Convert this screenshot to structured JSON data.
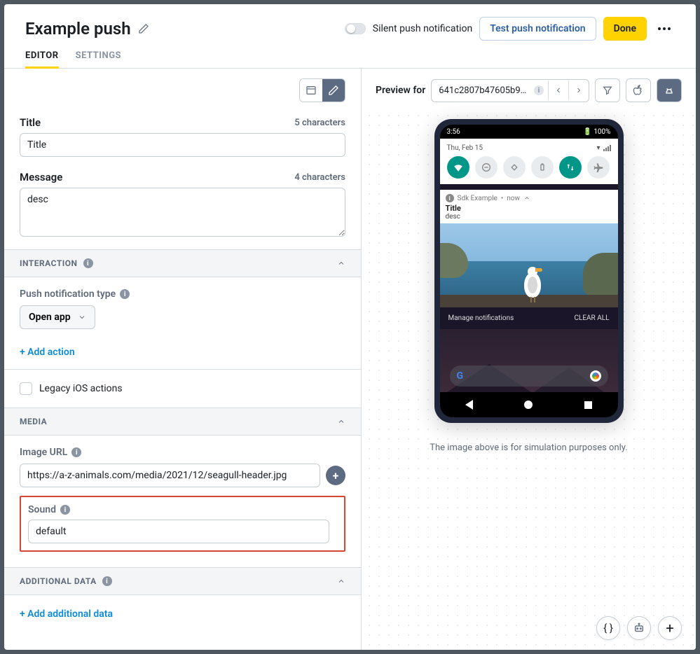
{
  "header": {
    "title": "Example push",
    "silent_label": "Silent push notification",
    "test_btn": "Test push notification",
    "done_btn": "Done"
  },
  "tabs": {
    "editor": "EDITOR",
    "settings": "SETTINGS"
  },
  "form": {
    "title_label": "Title",
    "title_count": "5 characters",
    "title_value": "Title",
    "message_label": "Message",
    "message_count": "4 characters",
    "message_value": "desc"
  },
  "interaction": {
    "section": "INTERACTION",
    "type_label": "Push notification type",
    "type_value": "Open app",
    "add_action": "+ Add action",
    "legacy_label": "Legacy iOS actions"
  },
  "media": {
    "section": "MEDIA",
    "image_label": "Image URL",
    "image_value": "https://a-z-animals.com/media/2021/12/seagull-header.jpg",
    "sound_label": "Sound",
    "sound_value": "default"
  },
  "additional": {
    "section": "ADDITIONAL DATA",
    "add_link": "+ Add additional data"
  },
  "preview": {
    "for_label": "Preview for",
    "id": "641c2807b47605b9...",
    "phone": {
      "time": "3:56",
      "battery": "100%",
      "date": "Thu, Feb 15",
      "app": "Sdk Example",
      "when": "now",
      "title": "Title",
      "desc": "desc",
      "manage": "Manage notifications",
      "clear": "CLEAR ALL"
    },
    "note": "The image above is for simulation purposes only."
  }
}
